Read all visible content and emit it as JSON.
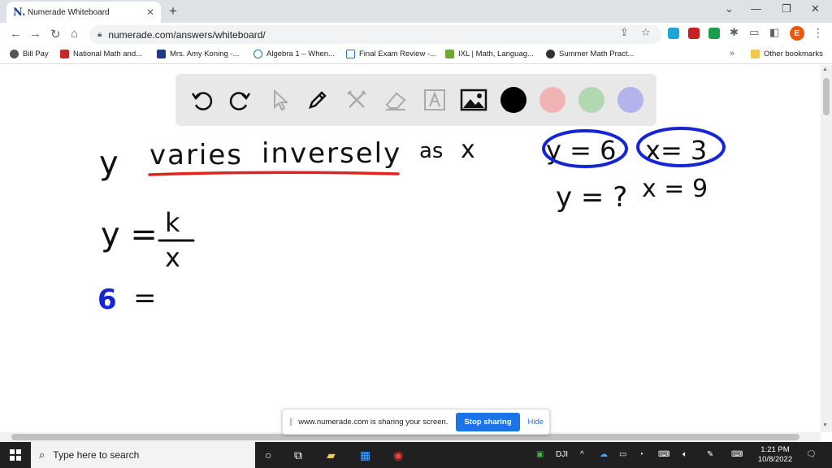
{
  "browser": {
    "tab_title": "Numerade Whiteboard",
    "tab_favicon": "N.",
    "url": "numerade.com/answers/whiteboard/",
    "profile_initial": "E",
    "bookmarks": [
      "Bill Pay",
      "National Math and...",
      "Mrs. Amy Koning -...",
      "Algebra 1 – When...",
      "Final Exam Review -...",
      "IXL | Math, Languag...",
      "Summer Math Pract..."
    ],
    "bookmarks_overflow": "»",
    "other_bookmarks": "Other bookmarks"
  },
  "whiteboard": {
    "tools": [
      "undo-icon",
      "redo-icon",
      "pointer-icon",
      "pen-icon",
      "tools-icon",
      "eraser-icon",
      "text-icon",
      "image-icon"
    ],
    "colors": [
      "#000000",
      "#f0b4b4",
      "#b2d8b2",
      "#b4b4ec"
    ],
    "ink_colors": {
      "black": "#111111",
      "red": "#e0261c",
      "blue": "#1525d6"
    },
    "handwriting": {
      "line1_y": "y",
      "line1_varies": "varies",
      "line1_inversely": "inversely",
      "line1_as": "as",
      "line1_x": "x",
      "given_y": "y = 6",
      "given_x": "x= 3",
      "find_y": "y = ?",
      "find_x": "x = 9",
      "formula_lhs": "y =",
      "formula_num": "k",
      "formula_den": "x",
      "sub_value": "6",
      "sub_eq": "="
    }
  },
  "share_bar": {
    "message": "www.numerade.com is sharing your screen.",
    "stop_label": "Stop sharing",
    "hide_label": "Hide"
  },
  "taskbar": {
    "search_placeholder": "Type here to search",
    "tray_label": "DJI",
    "time": "1:21 PM",
    "date": "10/8/2022"
  }
}
